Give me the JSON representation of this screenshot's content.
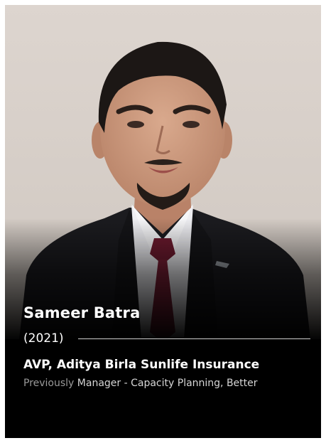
{
  "profile": {
    "name": "Sameer Batra",
    "year": "(2021)",
    "current_title": "AVP, Aditya Birla Sunlife Insurance",
    "previous_prefix": "Previously",
    "previous_role": "Manager - Capacity Planning, Better"
  },
  "colors": {
    "card_background": "#000000",
    "wall_background": "#d9d2cc",
    "tie": "#7a1f35",
    "suit": "#1a1a1d"
  }
}
